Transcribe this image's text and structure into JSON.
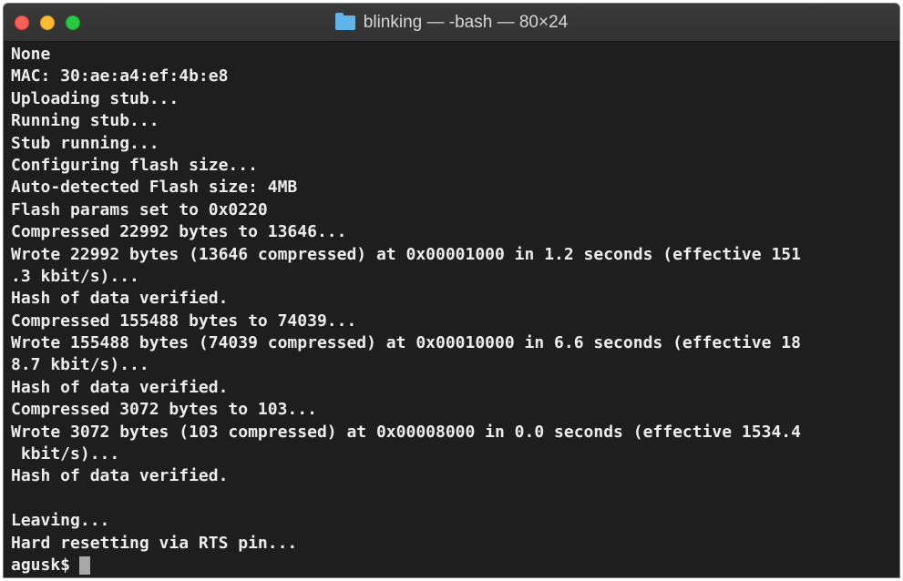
{
  "window": {
    "title": "blinking — -bash — 80×24",
    "folder_icon": "folder-icon"
  },
  "terminal": {
    "lines": [
      "None",
      "MAC: 30:ae:a4:ef:4b:e8",
      "Uploading stub...",
      "Running stub...",
      "Stub running...",
      "Configuring flash size...",
      "Auto-detected Flash size: 4MB",
      "Flash params set to 0x0220",
      "Compressed 22992 bytes to 13646...",
      "Wrote 22992 bytes (13646 compressed) at 0x00001000 in 1.2 seconds (effective 151",
      ".3 kbit/s)...",
      "Hash of data verified.",
      "Compressed 155488 bytes to 74039...",
      "Wrote 155488 bytes (74039 compressed) at 0x00010000 in 6.6 seconds (effective 18",
      "8.7 kbit/s)...",
      "Hash of data verified.",
      "Compressed 3072 bytes to 103...",
      "Wrote 3072 bytes (103 compressed) at 0x00008000 in 0.0 seconds (effective 1534.4",
      " kbit/s)...",
      "Hash of data verified.",
      "",
      "Leaving...",
      "Hard resetting via RTS pin..."
    ],
    "prompt": "agusk$"
  }
}
